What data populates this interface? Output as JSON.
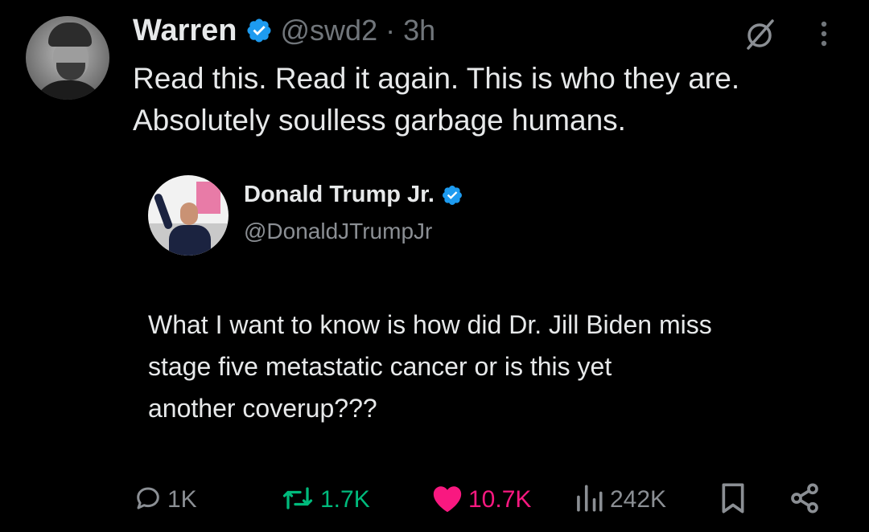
{
  "post": {
    "author_name": "Warren",
    "handle": "@swd2",
    "separator": "·",
    "time": "3h",
    "text_lines": [
      "Read this. Read it again. This is who they are.",
      "Absolutely soulless garbage humans."
    ]
  },
  "quote": {
    "author_name": "Donald Trump Jr.",
    "handle": "@DonaldJTrumpJr",
    "text_lines": [
      "What I want to know is how did Dr. Jill Biden miss",
      "stage five metastatic cancer or is this yet",
      "another coverup???"
    ]
  },
  "actions": {
    "replies": "1K",
    "reposts": "1.7K",
    "likes": "10.7K",
    "views": "242K"
  },
  "icons": {
    "verified": "verified-badge-icon",
    "grok": "grok-icon",
    "more": "more-vertical-icon",
    "reply": "reply-icon",
    "repost": "repost-icon",
    "like": "heart-icon",
    "views": "views-chart-icon",
    "bookmark": "bookmark-icon",
    "share": "share-icon"
  },
  "colors": {
    "background": "#000000",
    "text": "#e7e9ea",
    "secondary": "#71767b",
    "verified": "#1d9bf0",
    "repost_active": "#00ba7c",
    "like_active": "#f91880"
  }
}
